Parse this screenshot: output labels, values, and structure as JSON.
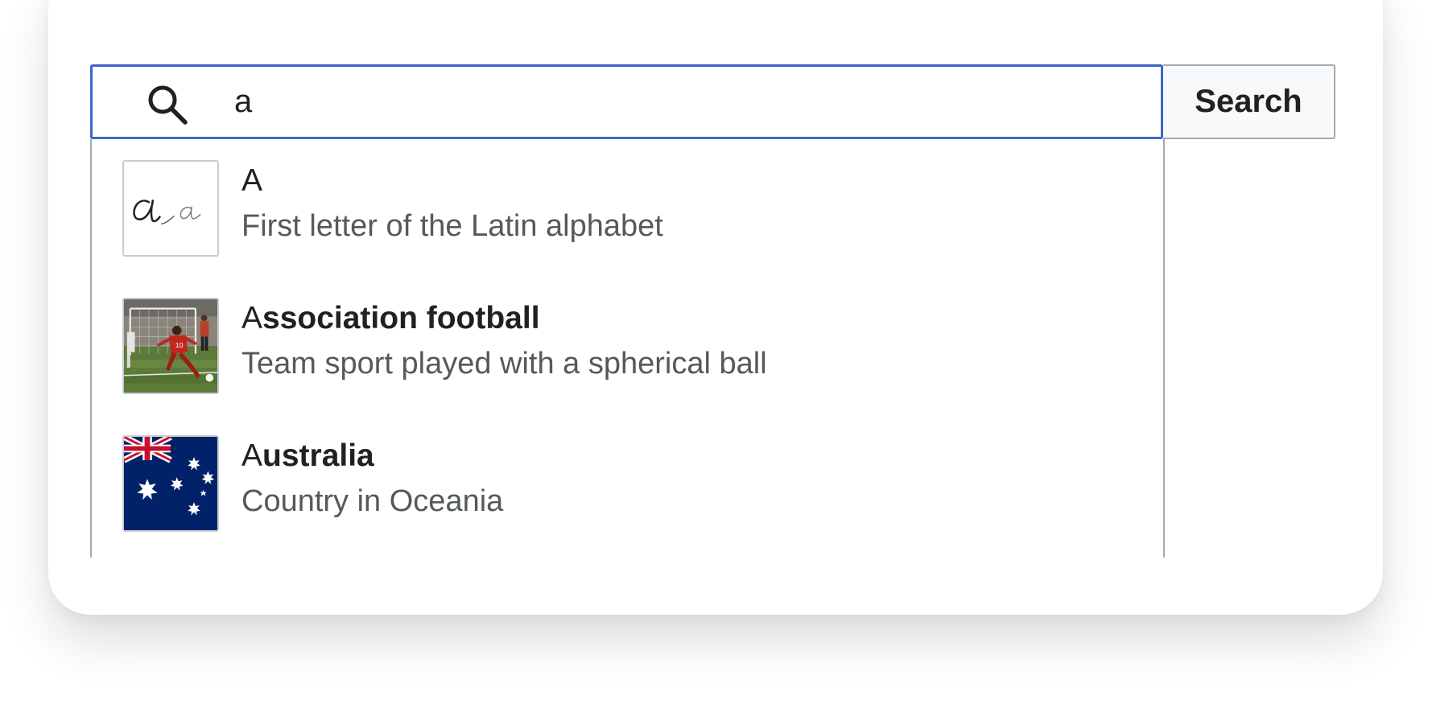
{
  "search": {
    "value": "a",
    "button_label": "Search"
  },
  "icons": {
    "search": "search-icon"
  },
  "colors": {
    "focus_border": "#3a66cc",
    "button_background": "#f8f9fa",
    "description_text": "#54595d"
  },
  "suggestions": [
    {
      "match": "A",
      "rest": "",
      "description": "First letter of the Latin alphabet",
      "thumbnail": "cursive-letter-a"
    },
    {
      "match": "A",
      "rest": "ssociation football",
      "description": "Team sport played with a spherical ball",
      "thumbnail": "football-player-photo"
    },
    {
      "match": "A",
      "rest": "ustralia",
      "description": "Country in Oceania",
      "thumbnail": "australia-flag"
    }
  ]
}
